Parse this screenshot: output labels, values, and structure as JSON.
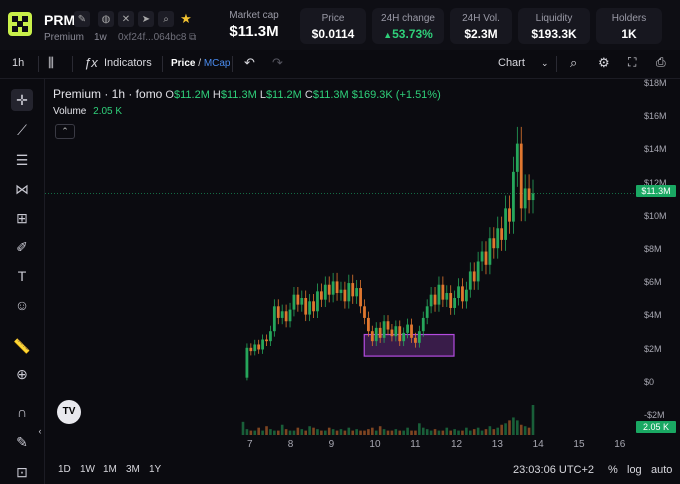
{
  "token": {
    "symbol": "PRM",
    "name": "Premium",
    "age": "1w",
    "address": "0xf24f...064bc8"
  },
  "stats": {
    "market_cap": {
      "label": "Market cap",
      "value": "$11.3M"
    },
    "price": {
      "label": "Price",
      "value": "$0.0114"
    },
    "change_24h": {
      "label": "24H change",
      "value": "53.73%",
      "arrow": "▲"
    },
    "vol_24h": {
      "label": "24H Vol.",
      "value": "$2.3M"
    },
    "liquidity": {
      "label": "Liquidity",
      "value": "$193.3K"
    },
    "holders": {
      "label": "Holders",
      "value": "1K"
    }
  },
  "toolbar": {
    "interval": "1h",
    "indicators": "Indicators",
    "price": "Price",
    "slash": "/",
    "mcap": "MCap",
    "chart": "Chart"
  },
  "legend": {
    "title": "Premium · 1h · fomo",
    "o_label": "O",
    "o": "$11.2M",
    "h_label": "H",
    "h": "$11.3M",
    "l_label": "L",
    "l": "$11.2M",
    "c_label": "C",
    "c": "$11.3M",
    "change": "$169.3K (+1.51%)",
    "volume_label": "Volume",
    "volume": "2.05 K"
  },
  "y_ticks": [
    "$18M",
    "$16M",
    "$14M",
    "$12M",
    "$10M",
    "$8M",
    "$6M",
    "$4M",
    "$2M",
    "$0",
    "-$2M"
  ],
  "current_price_tag": "$11.3M",
  "volume_tag": "2.05 K",
  "x_ticks": [
    "7",
    "8",
    "9",
    "10",
    "11",
    "12",
    "13",
    "14",
    "15",
    "16"
  ],
  "ranges": [
    "1D",
    "1W",
    "1M",
    "3M",
    "1Y"
  ],
  "clock": "23:03:06 UTC+2",
  "bottom_controls": {
    "percent": "%",
    "log": "log",
    "auto": "auto"
  },
  "colors": {
    "up": "#26a65b",
    "down": "#e0772f",
    "highlight": "#b44be0",
    "accent": "#2fd07a"
  },
  "chart_data": {
    "type": "candlestick",
    "x_ticks": [
      "7",
      "8",
      "9",
      "10",
      "11",
      "12",
      "13",
      "14",
      "15",
      "16"
    ],
    "ylim": [
      -2,
      18
    ],
    "price_series_M": [
      0.2,
      2.0,
      1.8,
      2.2,
      1.9,
      2.5,
      2.4,
      3.0,
      4.5,
      3.8,
      4.2,
      3.6,
      4.3,
      5.2,
      4.6,
      5.0,
      4.0,
      4.8,
      4.2,
      5.4,
      4.9,
      5.8,
      5.2,
      6.0,
      5.3,
      5.5,
      4.8,
      5.9,
      5.1,
      5.6,
      4.5,
      3.8,
      3.0,
      2.4,
      3.2,
      2.6,
      3.6,
      3.1,
      2.7,
      3.3,
      2.4,
      2.9,
      3.4,
      2.6,
      2.3,
      3.0,
      3.8,
      4.5,
      5.2,
      4.6,
      5.8,
      4.9,
      5.3,
      4.4,
      5.0,
      5.7,
      4.8,
      5.5,
      6.6,
      6.0,
      7.2,
      7.8,
      7.0,
      8.6,
      8.0,
      9.2,
      8.5,
      10.4,
      9.6,
      12.6,
      14.3,
      10.4,
      11.6,
      10.9,
      11.3
    ],
    "volume_k": [
      0.9,
      0.4,
      0.3,
      0.3,
      0.5,
      0.3,
      0.6,
      0.4,
      0.3,
      0.3,
      0.7,
      0.4,
      0.3,
      0.3,
      0.5,
      0.4,
      0.3,
      0.6,
      0.5,
      0.4,
      0.3,
      0.3,
      0.5,
      0.4,
      0.3,
      0.4,
      0.3,
      0.5,
      0.3,
      0.4,
      0.3,
      0.3,
      0.4,
      0.5,
      0.3,
      0.6,
      0.4,
      0.3,
      0.3,
      0.4,
      0.3,
      0.3,
      0.5,
      0.3,
      0.3,
      0.8,
      0.5,
      0.4,
      0.3,
      0.4,
      0.3,
      0.3,
      0.5,
      0.3,
      0.4,
      0.3,
      0.3,
      0.5,
      0.3,
      0.4,
      0.5,
      0.3,
      0.4,
      0.6,
      0.4,
      0.5,
      0.7,
      0.8,
      1.0,
      1.2,
      1.0,
      0.7,
      0.6,
      0.5,
      2.05
    ],
    "highlight_box": {
      "x_from": "9.8",
      "x_to": "12.0",
      "y_from_M": 1.5,
      "y_to_M": 2.8
    }
  }
}
